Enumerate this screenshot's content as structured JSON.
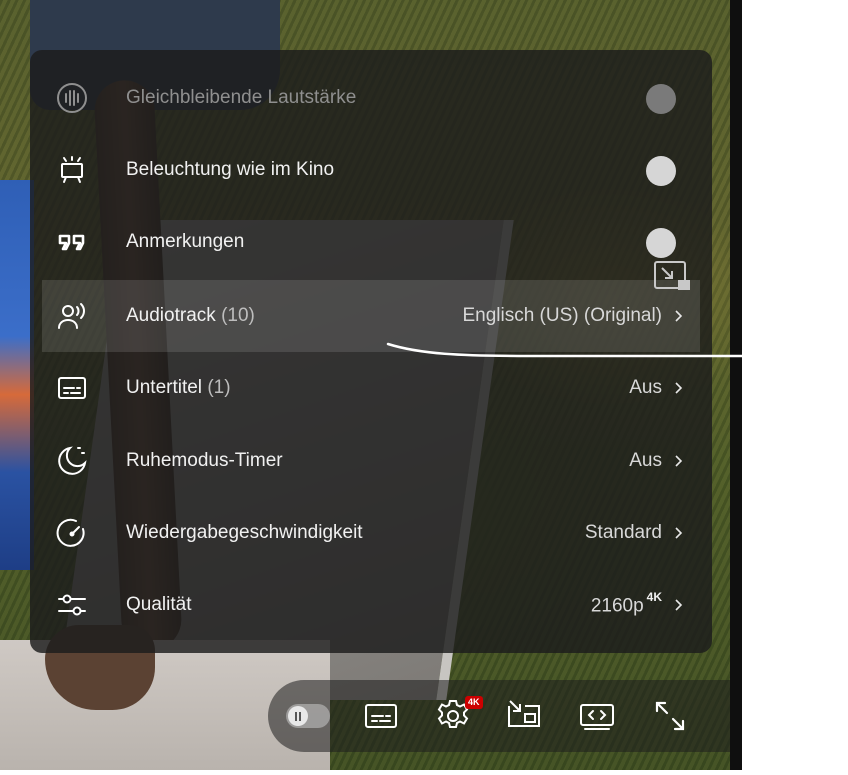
{
  "settings": {
    "items": [
      {
        "label": "Gleichbleibende Lautstärke",
        "count": "",
        "value": "",
        "icon": "stable-volume-icon",
        "type": "toggle",
        "enabled": false
      },
      {
        "label": "Beleuchtung wie im Kino",
        "count": "",
        "value": "",
        "icon": "ambient-mode-icon",
        "type": "toggle",
        "enabled": true
      },
      {
        "label": "Anmerkungen",
        "count": "",
        "value": "",
        "icon": "annotations-icon",
        "type": "toggle",
        "enabled": true
      },
      {
        "label": "Audiotrack",
        "count": "(10)",
        "value": "Englisch (US) (Original)",
        "icon": "audio-track-icon",
        "type": "submenu"
      },
      {
        "label": "Untertitel",
        "count": "(1)",
        "value": "Aus",
        "icon": "subtitles-icon",
        "type": "submenu"
      },
      {
        "label": "Ruhemodus-Timer",
        "count": "",
        "value": "Aus",
        "icon": "sleep-timer-icon",
        "type": "submenu"
      },
      {
        "label": "Wiedergabegeschwindigkeit",
        "count": "",
        "value": "Standard",
        "icon": "playback-speed-icon",
        "type": "submenu"
      },
      {
        "label": "Qualität",
        "count": "",
        "value": "2160p",
        "value_sup": "4K",
        "icon": "quality-icon",
        "type": "submenu"
      }
    ]
  },
  "controls": {
    "settings_badge": "4K",
    "buttons": [
      "autoplay-toggle",
      "subtitles-icon",
      "settings-gear-icon",
      "miniplayer-icon",
      "theater-mode-icon",
      "fullscreen-icon"
    ]
  },
  "colors": {
    "panel_bg": "#1c1c1c",
    "badge": "#cc0000",
    "text": "#f1f1f1"
  }
}
